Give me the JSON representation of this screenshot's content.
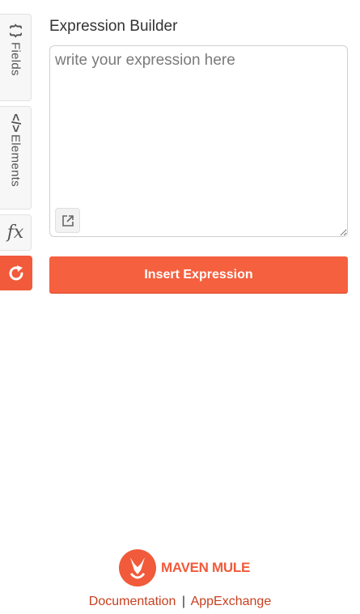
{
  "sidebar": {
    "fields_label": "Fields",
    "fields_glyph": "{ }",
    "elements_label": "Elements",
    "elements_glyph": "</>",
    "formula_glyph": "fx"
  },
  "editor": {
    "title": "Expression Builder",
    "placeholder": "write your expression here",
    "value": ""
  },
  "actions": {
    "insert_label": "Insert Expression"
  },
  "footer": {
    "brand": "MAVEN MULE",
    "documentation_label": "Documentation",
    "separator": "|",
    "appexchange_label": "AppExchange"
  },
  "colors": {
    "accent": "#f5603f",
    "link": "#c8401f"
  }
}
